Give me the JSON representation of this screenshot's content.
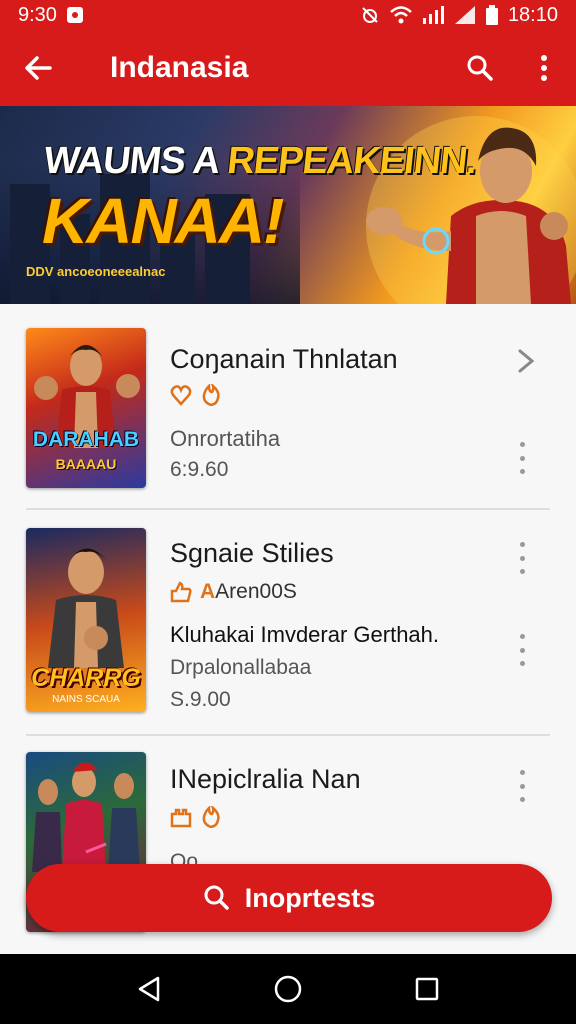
{
  "status_bar": {
    "time_left": "9:30",
    "time_right": "18:10"
  },
  "app_bar": {
    "title": "Indanasia"
  },
  "banner": {
    "headline_part1": "WAUMS A ",
    "headline_part2": "REPEAKEINN.",
    "headline_big": "KANAA!",
    "tagline": "DDV ancoeoneeealnac"
  },
  "items": [
    {
      "title": "Coŋanain Thnlatan",
      "subtitle": "Onrortatiha",
      "price": "6:9.60",
      "thumb_text": "DARAHAB",
      "thumb_subtext": "BAAAAU"
    },
    {
      "title": "Sgnaie Stilies",
      "rating_text": "Aren00S",
      "subtitle": "Kluhakai Imvderar Gerthah.",
      "subtitle2": "Drpalonallabaa",
      "price": "S.9.00",
      "thumb_text": "CHARRG",
      "thumb_subtext": "NAINS SCAUA"
    },
    {
      "title": "INepiclralia Nan",
      "partial_text": "Oo..."
    }
  ],
  "cta": {
    "label": "Inoprtests"
  },
  "colors": {
    "brand": "#d71a1a",
    "background": "#f2f2f2"
  }
}
